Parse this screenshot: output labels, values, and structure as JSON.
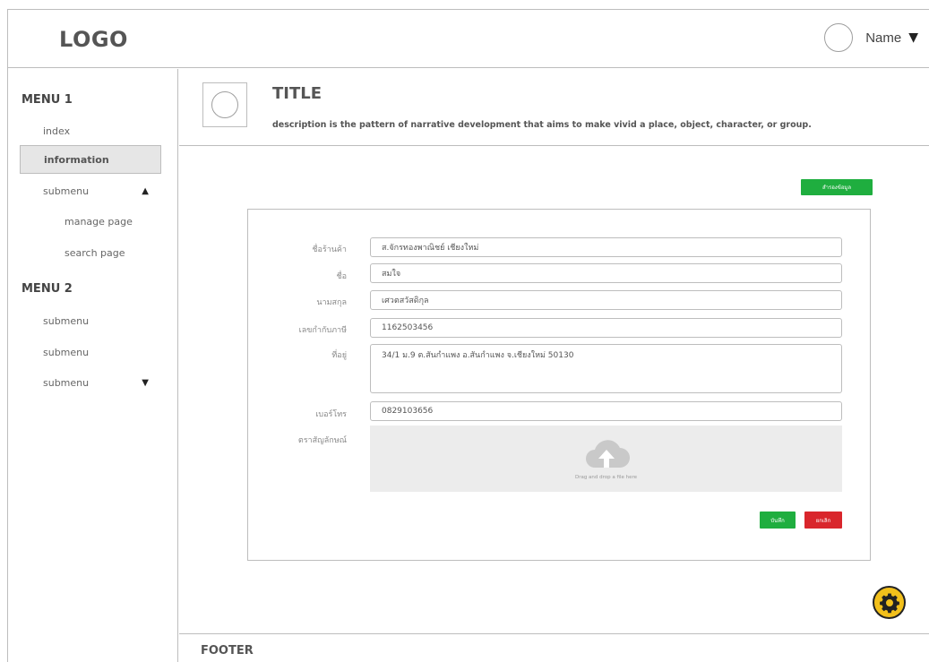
{
  "header": {
    "logo": "LOGO",
    "user_name": "Name",
    "caret": "▼"
  },
  "sidebar": {
    "menu1_title": "MENU 1",
    "menu1_items": [
      {
        "label": "index"
      },
      {
        "label": "information",
        "active": true
      },
      {
        "label": "submenu",
        "indicator": "▲"
      },
      {
        "label": "manage page"
      },
      {
        "label": "search page"
      }
    ],
    "menu2_title": "MENU 2",
    "menu2_items": [
      {
        "label": "submenu"
      },
      {
        "label": "submenu"
      },
      {
        "label": "submenu",
        "indicator": "▼"
      }
    ]
  },
  "titlebar": {
    "title": "TITLE",
    "description": "description is the pattern of narrative development that aims to make vivid a place, object, character, or group."
  },
  "toolbar": {
    "top_button_label": "สำรองข้อมูล"
  },
  "form": {
    "fields": [
      {
        "label": "ชื่อร้านค้า",
        "value": "ส.จักรทองพาณิชย์ เชียงใหม่"
      },
      {
        "label": "ชื่อ",
        "value": "สมใจ"
      },
      {
        "label": "นามสกุล",
        "value": "เศวตสวัสดิกุล"
      },
      {
        "label": "เลขกำกับภาษี",
        "value": "1162503456"
      },
      {
        "label": "ที่อยู่",
        "value": "34/1 ม.9 ต.สันกำแพง อ.สันกำแพง จ.เชียงใหม่ 50130"
      },
      {
        "label": "เบอร์โทร",
        "value": "0829103656"
      }
    ],
    "logo_label": "ตราสัญลักษณ์",
    "dropzone_text": "Drag and drop a file here",
    "save_label": "บันทึก",
    "cancel_label": "ยกเลิก"
  },
  "footer": {
    "text": "FOOTER"
  },
  "colors": {
    "green": "#1fae3f",
    "red": "#d9262c",
    "gear": "#f2c01b"
  }
}
